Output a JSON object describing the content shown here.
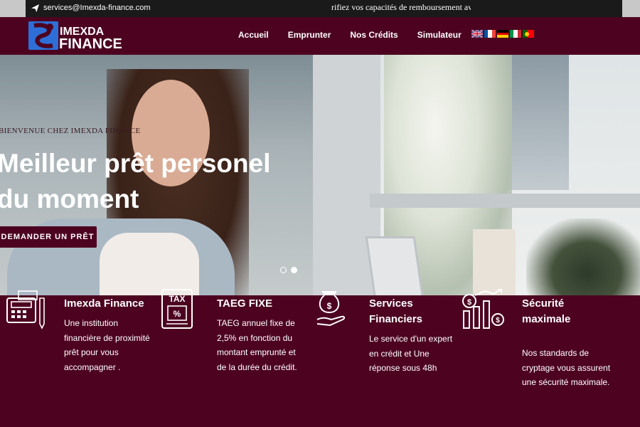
{
  "topbar": {
    "email": "services@Imexda-finance.com",
    "ticker": "rifiez vos capacités de remboursement avar"
  },
  "header": {
    "logo_line1": "IMEXDA",
    "logo_line2": "FINANCE",
    "nav": [
      "Accueil",
      "Emprunter",
      "Nos Crédits",
      "Simulateur"
    ],
    "flags": [
      "english",
      "french",
      "german",
      "italian",
      "portuguese"
    ]
  },
  "hero": {
    "kicker": "BIENVENUE CHEZ IMEXDA FINANCE",
    "headline_line1": "Meilleur prêt personel",
    "headline_line2": "du moment",
    "cta": "DEMANDER UN PRÊT",
    "slides": 2,
    "active_slide": 2
  },
  "features": [
    {
      "icon": "calculator-icon",
      "title": "Imexda Finance",
      "text": [
        "Une institution",
        "financière de proximité",
        "prêt pour vous",
        "accompagner ."
      ]
    },
    {
      "icon": "tax-icon",
      "title": "TAEG FIXE",
      "text": [
        "TAEG annuel fixe de",
        "2,5% en fonction du",
        "montant emprunté et",
        "de la durée du crédit."
      ]
    },
    {
      "icon": "money-hand-icon",
      "title_lines": [
        "Services",
        "Financiers"
      ],
      "text": [
        "Le service d'un expert",
        "en crédit et Une",
        "réponse sous 48h"
      ]
    },
    {
      "icon": "growth-chart-icon",
      "title_lines": [
        "Sécurité",
        "maximale"
      ],
      "text": [
        "Nos standards de",
        "cryptage vous assurent",
        "une sécurité maximale."
      ]
    }
  ],
  "colors": {
    "brand": "#4d0320",
    "topbar": "#1a1a1a",
    "logo_blue": "#2d6fd6"
  }
}
